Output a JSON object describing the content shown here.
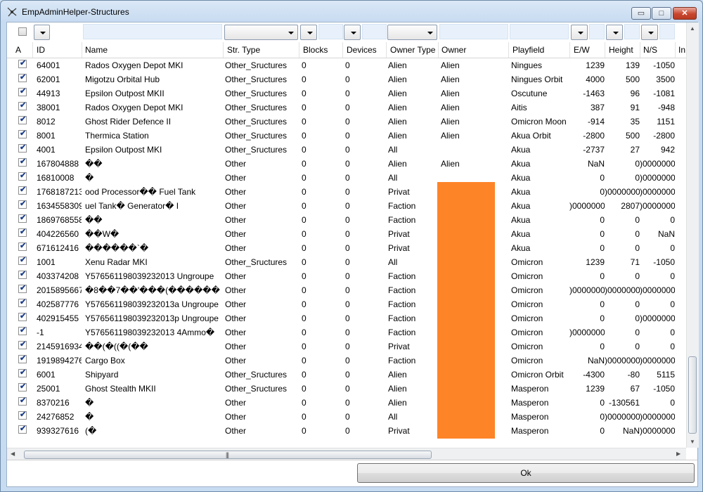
{
  "window": {
    "title": "EmpAdminHelper-Structures",
    "min_glyph": "▭",
    "max_glyph": "□",
    "close_glyph": "✕"
  },
  "columns": [
    "A",
    "ID",
    "Name",
    "Str. Type",
    "Blocks",
    "Devices",
    "Owner Type",
    "Owner",
    "Playfield",
    "E/W",
    "Height",
    "N/S",
    "In"
  ],
  "rows": [
    {
      "checked": true,
      "id": "64001",
      "name": "Rados Oxygen Depot MKI",
      "str_type": "Other_Sructures",
      "blocks": "0",
      "devices": "0",
      "owner_type": "Alien",
      "owner": "Alien",
      "playfield": "Ningues",
      "ew": "1239",
      "height": "139",
      "ns": "-1050"
    },
    {
      "checked": true,
      "id": "62001",
      "name": "Migotzu Orbital Hub",
      "str_type": "Other_Sructures",
      "blocks": "0",
      "devices": "0",
      "owner_type": "Alien",
      "owner": "Alien",
      "playfield": "Ningues Orbit",
      "ew": "4000",
      "height": "500",
      "ns": "3500"
    },
    {
      "checked": true,
      "id": "44913",
      "name": "Epsilon Outpost MKII",
      "str_type": "Other_Sructures",
      "blocks": "0",
      "devices": "0",
      "owner_type": "Alien",
      "owner": "Alien",
      "playfield": "Oscutune",
      "ew": "-1463",
      "height": "96",
      "ns": "-1081"
    },
    {
      "checked": true,
      "id": "38001",
      "name": "Rados Oxygen Depot MKI",
      "str_type": "Other_Sructures",
      "blocks": "0",
      "devices": "0",
      "owner_type": "Alien",
      "owner": "Alien",
      "playfield": "Aitis",
      "ew": "387",
      "height": "91",
      "ns": "-948"
    },
    {
      "checked": true,
      "id": "8012",
      "name": "Ghost Rider Defence II",
      "str_type": "Other_Sructures",
      "blocks": "0",
      "devices": "0",
      "owner_type": "Alien",
      "owner": "Alien",
      "playfield": "Omicron Moon",
      "ew": "-914",
      "height": "35",
      "ns": "1151"
    },
    {
      "checked": true,
      "id": "8001",
      "name": "Thermica Station",
      "str_type": "Other_Sructures",
      "blocks": "0",
      "devices": "0",
      "owner_type": "Alien",
      "owner": "Alien",
      "playfield": "Akua Orbit",
      "ew": "-2800",
      "height": "500",
      "ns": "-2800"
    },
    {
      "checked": true,
      "id": "4001",
      "name": "Epsilon Outpost MKI",
      "str_type": "Other_Sructures",
      "blocks": "0",
      "devices": "0",
      "owner_type": "All",
      "owner": "",
      "playfield": "Akua",
      "ew": "-2737",
      "height": "27",
      "ns": "942"
    },
    {
      "checked": true,
      "id": "167804888",
      "name": "��",
      "str_type": "Other",
      "blocks": "0",
      "devices": "0",
      "owner_type": "Alien",
      "owner": "Alien",
      "playfield": "Akua",
      "ew": "NaN",
      "height": "0",
      "ns": ")0000000"
    },
    {
      "checked": true,
      "id": "16810008",
      "name": "�",
      "str_type": "Other",
      "blocks": "0",
      "devices": "0",
      "owner_type": "All",
      "owner": "",
      "playfield": "Akua",
      "ew": "0",
      "height": "0",
      "ns": ")0000000"
    },
    {
      "checked": true,
      "id": "1768187213",
      "name": "ood Processor��               Fuel Tank",
      "str_type": "Other",
      "blocks": "0",
      "devices": "0",
      "owner_type": "Privat",
      "owner": "",
      "playfield": "Akua",
      "ew": "0",
      "height": ")0000000",
      "ns": ")0000000"
    },
    {
      "checked": true,
      "id": "1634558309",
      "name": "uel Tank�             Generator�          I",
      "str_type": "Other",
      "blocks": "0",
      "devices": "0",
      "owner_type": "Faction",
      "owner": "",
      "playfield": "Akua",
      "ew": ")0000000",
      "height": "2807",
      "ns": ")0000000"
    },
    {
      "checked": true,
      "id": "1869768558",
      "name": "��",
      "str_type": "Other",
      "blocks": "0",
      "devices": "0",
      "owner_type": "Faction",
      "owner": "",
      "playfield": "Akua",
      "ew": "0",
      "height": "0",
      "ns": "0"
    },
    {
      "checked": true,
      "id": "404226560",
      "name": "��W�",
      "str_type": "Other",
      "blocks": "0",
      "devices": "0",
      "owner_type": "Privat",
      "owner": "",
      "playfield": "Akua",
      "ew": "0",
      "height": "0",
      "ns": "NaN"
    },
    {
      "checked": true,
      "id": "671612416",
      "name": "������`�",
      "str_type": "Other",
      "blocks": "0",
      "devices": "0",
      "owner_type": "Privat",
      "owner": "",
      "playfield": "Akua",
      "ew": "0",
      "height": "0",
      "ns": "0"
    },
    {
      "checked": true,
      "id": "1001",
      "name": "Xenu Radar MKI",
      "str_type": "Other_Sructures",
      "blocks": "0",
      "devices": "0",
      "owner_type": "All",
      "owner": "",
      "playfield": "Omicron",
      "ew": "1239",
      "height": "71",
      "ns": "-1050"
    },
    {
      "checked": true,
      "id": "403374208",
      "name": "Y576561198039232013        Ungroupe",
      "str_type": "Other",
      "blocks": "0",
      "devices": "0",
      "owner_type": "Faction",
      "owner": "",
      "playfield": "Omicron",
      "ew": "0",
      "height": "0",
      "ns": "0"
    },
    {
      "checked": true,
      "id": "2015895667",
      "name": "�8��7��'���(������",
      "str_type": "Other",
      "blocks": "0",
      "devices": "0",
      "owner_type": "Faction",
      "owner": "",
      "playfield": "Omicron",
      "ew": ")0000000",
      "height": ")0000000",
      "ns": ")0000000"
    },
    {
      "checked": true,
      "id": "402587776",
      "name": "Y576561198039232013a       Ungroupe",
      "str_type": "Other",
      "blocks": "0",
      "devices": "0",
      "owner_type": "Faction",
      "owner": "",
      "playfield": "Omicron",
      "ew": "0",
      "height": "0",
      "ns": "0"
    },
    {
      "checked": true,
      "id": "402915455",
      "name": "Y576561198039232013p       Ungroupe",
      "str_type": "Other",
      "blocks": "0",
      "devices": "0",
      "owner_type": "Faction",
      "owner": "",
      "playfield": "Omicron",
      "ew": "0",
      "height": "0",
      "ns": ")0000000"
    },
    {
      "checked": true,
      "id": "-1",
      "name": "Y576561198039232013 4Ammo�",
      "str_type": "Other",
      "blocks": "0",
      "devices": "0",
      "owner_type": "Faction",
      "owner": "",
      "playfield": "Omicron",
      "ew": ")0000000",
      "height": "0",
      "ns": "0"
    },
    {
      "checked": true,
      "id": "2145916934",
      "name": "��(�((�(��",
      "str_type": "Other",
      "blocks": "0",
      "devices": "0",
      "owner_type": "Privat",
      "owner": "",
      "playfield": "Omicron",
      "ew": "0",
      "height": "0",
      "ns": "0"
    },
    {
      "checked": true,
      "id": "1919894276",
      "name": "Cargo Box",
      "str_type": "Other",
      "blocks": "0",
      "devices": "0",
      "owner_type": "Faction",
      "owner": "",
      "playfield": "Omicron",
      "ew": "NaN",
      "height": ")0000000",
      "ns": ")0000000"
    },
    {
      "checked": true,
      "id": "6001",
      "name": "Shipyard",
      "str_type": "Other_Sructures",
      "blocks": "0",
      "devices": "0",
      "owner_type": "Alien",
      "owner": "",
      "playfield": "Omicron Orbit",
      "ew": "-4300",
      "height": "-80",
      "ns": "5115"
    },
    {
      "checked": true,
      "id": "25001",
      "name": "Ghost Stealth MKII",
      "str_type": "Other_Sructures",
      "blocks": "0",
      "devices": "0",
      "owner_type": "Alien",
      "owner": "",
      "playfield": "Masperon",
      "ew": "1239",
      "height": "67",
      "ns": "-1050"
    },
    {
      "checked": true,
      "id": "8370216",
      "name": "�",
      "str_type": "Other",
      "blocks": "0",
      "devices": "0",
      "owner_type": "Alien",
      "owner": "",
      "playfield": "Masperon",
      "ew": "0",
      "height": "-130561",
      "ns": "0"
    },
    {
      "checked": true,
      "id": "24276852",
      "name": "�",
      "str_type": "Other",
      "blocks": "0",
      "devices": "0",
      "owner_type": "All",
      "owner": "",
      "playfield": "Masperon",
      "ew": "0",
      "height": ")0000000",
      "ns": ")0000000"
    },
    {
      "checked": true,
      "id": "939327616",
      "name": "(�",
      "str_type": "Other",
      "blocks": "0",
      "devices": "0",
      "owner_type": "Privat",
      "owner": "",
      "playfield": "Masperon",
      "ew": "0",
      "height": "NaN",
      "ns": ")0000000"
    }
  ],
  "colors": {
    "owner_highlight": "#fe8428",
    "check": "#1d3f8a"
  },
  "scroll": {
    "h_grip": "|||"
  },
  "footer": {
    "ok_label": "Ok"
  }
}
